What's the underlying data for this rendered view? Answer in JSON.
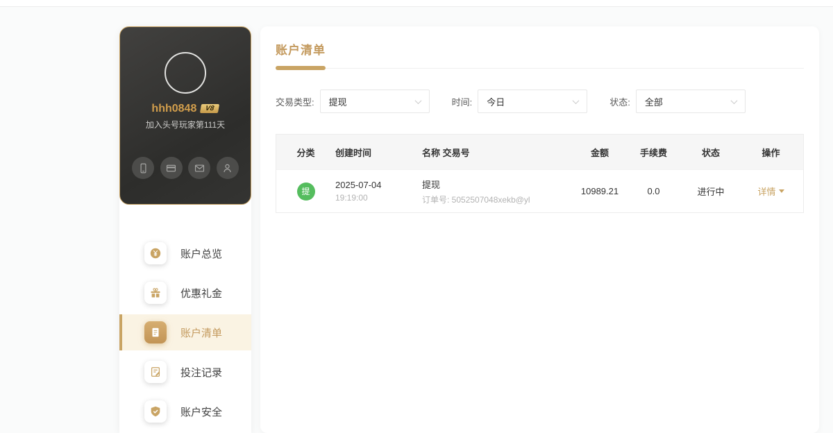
{
  "profile_card": {
    "username": "hhh0848",
    "vip_badge": "V8",
    "join_text": "加入头号玩家第111天",
    "quick_actions": [
      {
        "icon": "phone-icon"
      },
      {
        "icon": "bank-card-icon"
      },
      {
        "icon": "mail-icon"
      },
      {
        "icon": "user-icon"
      }
    ]
  },
  "sidebar": {
    "items": [
      {
        "label": "账户总览",
        "icon": "coin-icon",
        "active": false
      },
      {
        "label": "优惠礼金",
        "icon": "gift-icon",
        "active": false
      },
      {
        "label": "账户清单",
        "icon": "document-icon",
        "active": true
      },
      {
        "label": "投注记录",
        "icon": "notepad-icon",
        "active": false
      },
      {
        "label": "账户安全",
        "icon": "shield-icon",
        "active": false
      }
    ]
  },
  "main": {
    "title": "账户清单",
    "filters": [
      {
        "label": "交易类型:",
        "value": "提现"
      },
      {
        "label": "时间:",
        "value": "今日"
      },
      {
        "label": "状态:",
        "value": "全部"
      }
    ],
    "table": {
      "headers": [
        "分类",
        "创建时间",
        "名称 交易号",
        "金额",
        "手续费",
        "状态",
        "操作"
      ],
      "rows": [
        {
          "category_badge": "提",
          "created_date": "2025-07-04",
          "created_time": "19:19:00",
          "name": "提现",
          "order_no": "订单号: 5052507048xekb@yl",
          "amount": "10989.21",
          "fee": "0.0",
          "status": "进行中",
          "action": "详情"
        }
      ]
    }
  },
  "colors": {
    "accent_gold": "#c9a464",
    "active_item_bg": "#faf3e3",
    "badge_green": "#55bd5e",
    "username_gold": "#d29e4c"
  }
}
